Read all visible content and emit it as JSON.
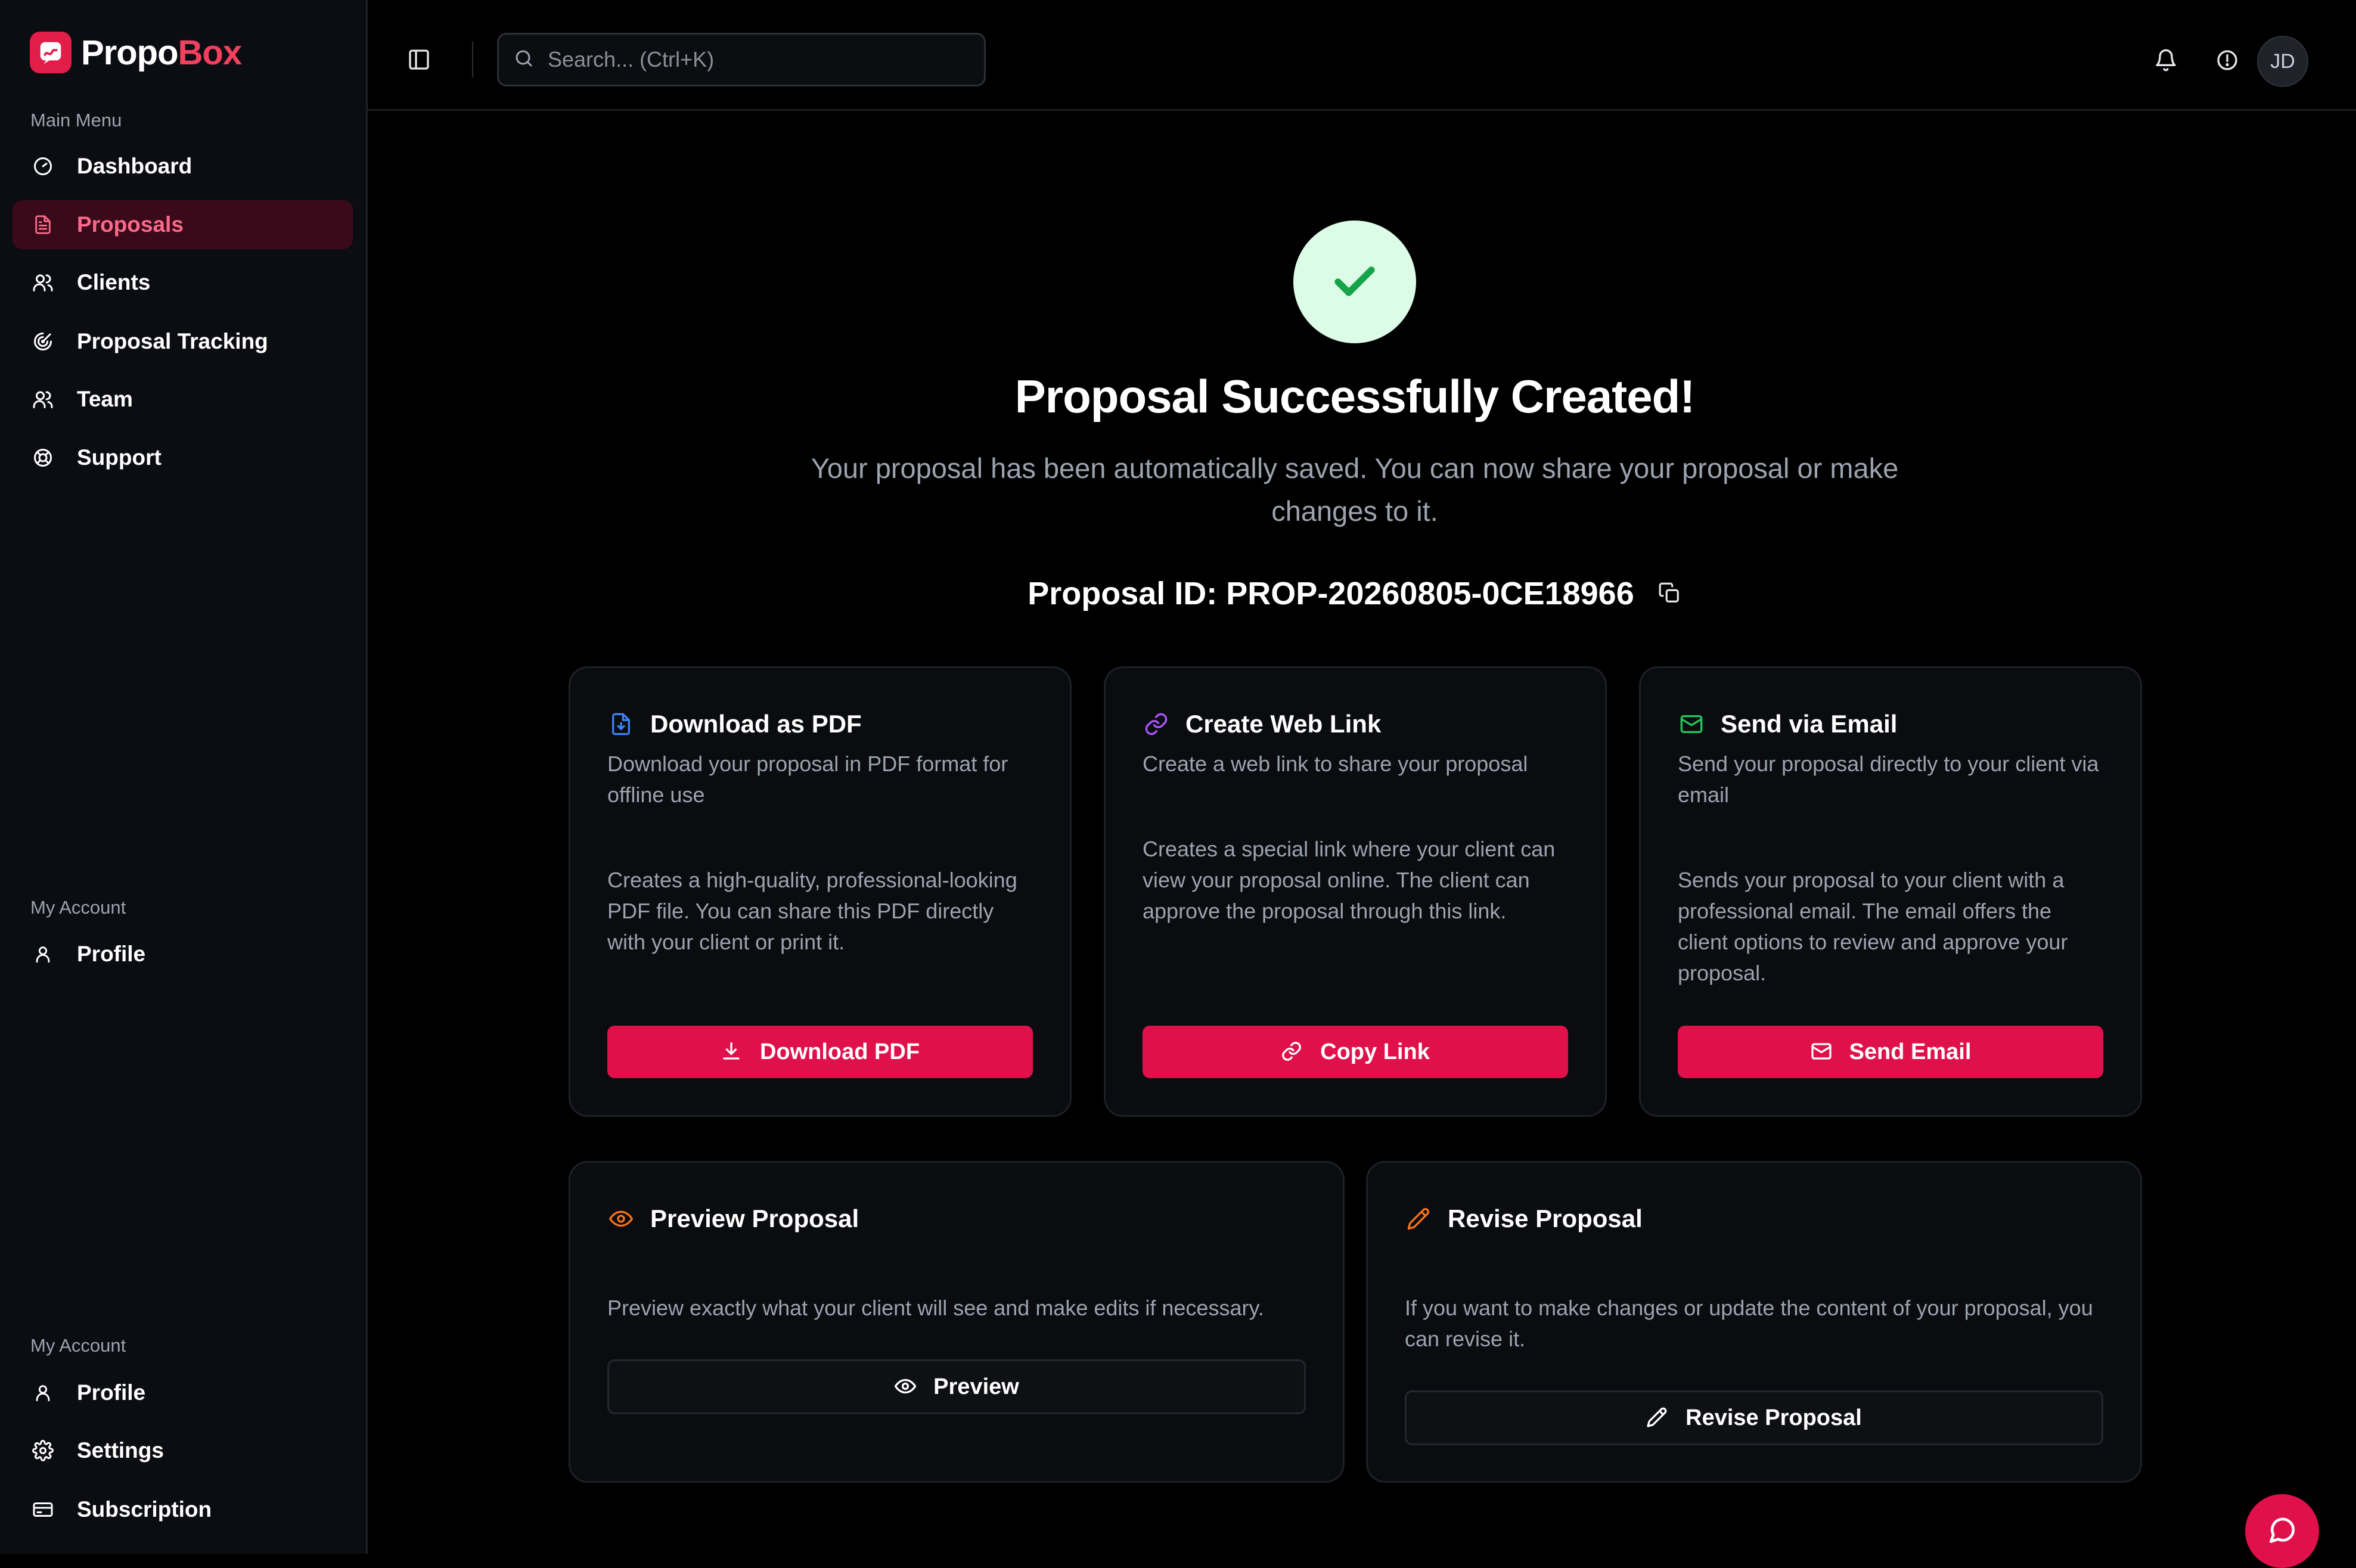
{
  "app": {
    "name_part1": "Propo",
    "name_part2": "Box",
    "brand_color": "#e11d48"
  },
  "sidebar": {
    "main_menu_label": "Main Menu",
    "main_items": [
      {
        "label": "Dashboard",
        "icon": "gauge-icon"
      },
      {
        "label": "Proposals",
        "icon": "file-text-icon",
        "active": true
      },
      {
        "label": "Clients",
        "icon": "users-icon"
      },
      {
        "label": "Proposal Tracking",
        "icon": "radar-icon"
      },
      {
        "label": "Team",
        "icon": "users-icon"
      },
      {
        "label": "Support",
        "icon": "life-buoy-icon"
      }
    ],
    "account_label_1": "My Account",
    "account_items_1": [
      {
        "label": "Profile",
        "icon": "user-icon"
      }
    ],
    "account_label_2": "My Account",
    "account_items_2": [
      {
        "label": "Profile",
        "icon": "user-icon"
      },
      {
        "label": "Settings",
        "icon": "gear-icon"
      },
      {
        "label": "Subscription",
        "icon": "credit-card-icon"
      }
    ]
  },
  "topbar": {
    "search_placeholder": "Search... (Ctrl+K)",
    "avatar_initials": "JD"
  },
  "hero": {
    "title": "Proposal Successfully Created!",
    "subtitle": "Your proposal has been automatically saved. You can now share your proposal or make changes to it.",
    "proposal_id_text": "Proposal ID: PROP-20260805-0CE18966"
  },
  "cards": {
    "pdf": {
      "title": "Download as PDF",
      "desc": "Download your proposal in PDF format for offline use",
      "detail": "Creates a high-quality, professional-looking PDF file. You can share this PDF directly with your client or print it.",
      "button": "Download PDF",
      "icon_color": "#3b82f6"
    },
    "link": {
      "title": "Create Web Link",
      "desc": "Create a web link to share your proposal",
      "detail": "Creates a special link where your client can view your proposal online. The client can approve the proposal through this link.",
      "button": "Copy Link",
      "icon_color": "#a855f7"
    },
    "email": {
      "title": "Send via Email",
      "desc": "Send your proposal directly to your client via email",
      "detail": "Sends your proposal to your client with a professional email. The email offers the client options to review and approve your proposal.",
      "button": "Send Email",
      "icon_color": "#22c55e"
    },
    "preview": {
      "title": "Preview Proposal",
      "desc": "Preview exactly what your client will see and make edits if necessary.",
      "button": "Preview",
      "icon_color": "#f97316"
    },
    "revise": {
      "title": "Revise Proposal",
      "desc": "If you want to make changes or update the content of your proposal, you can revise it.",
      "button": "Revise Proposal",
      "icon_color": "#f97316"
    }
  },
  "accent_button_color": "#e0104a",
  "success_color": "#16a34a"
}
